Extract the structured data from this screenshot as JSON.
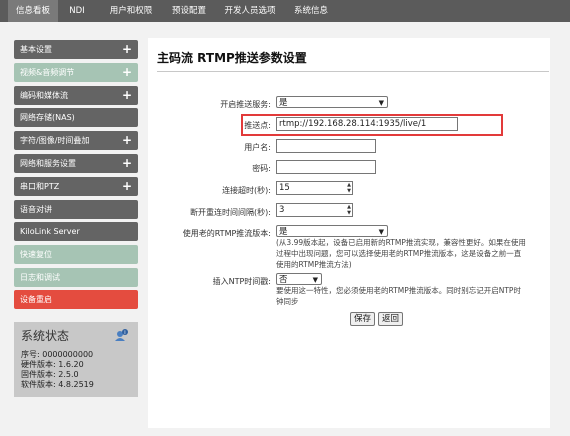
{
  "nav": {
    "tabs": [
      {
        "label": "信息看板"
      },
      {
        "label": "NDI"
      },
      {
        "label": "用户和权限"
      },
      {
        "label": "预设配置"
      },
      {
        "label": "开发人员选项"
      },
      {
        "label": "系统信息"
      }
    ]
  },
  "sidebar": {
    "items": [
      {
        "label": "基本设置",
        "plus": "+"
      },
      {
        "label": "视频&音频调节",
        "plus": "+"
      },
      {
        "label": "编码和媒体流",
        "plus": "+"
      },
      {
        "label": "网络存储(NAS)",
        "plus": ""
      },
      {
        "label": "字符/图像/时间叠加",
        "plus": "+"
      },
      {
        "label": "网络和服务设置",
        "plus": "+"
      },
      {
        "label": "串口和PTZ",
        "plus": "+"
      },
      {
        "label": "语音对讲",
        "plus": ""
      },
      {
        "label": "KiloLink Server",
        "plus": ""
      },
      {
        "label": "快速复位",
        "plus": ""
      },
      {
        "label": "日志和调试",
        "plus": ""
      },
      {
        "label": "设备重启",
        "plus": ""
      }
    ]
  },
  "status": {
    "title": "系统状态",
    "serial": "序号: 0000000000",
    "hardware": "硬件版本: 1.6.20",
    "firmware": "固件版本: 2.5.0",
    "software": "软件版本: 4.8.2519"
  },
  "form": {
    "title": "主码流 RTMP推送参数设置",
    "enable_label": "开启推送服务:",
    "enable_value": "是",
    "push_label": "推送点:",
    "push_value": "rtmp://192.168.28.114:1935/live/1",
    "user_label": "用户名:",
    "user_value": "",
    "pass_label": "密码:",
    "pass_value": "",
    "timeout_label": "连接超时(秒):",
    "timeout_value": "15",
    "reconnect_label": "断开重连时间间隔(秒):",
    "reconnect_value": "3",
    "legacy_label": "使用老的RTMP推流版本:",
    "legacy_value": "是",
    "legacy_note": [
      "(从3.99版本起，设备已启用新的RTMP推流实现，兼容性更好。如果在使用",
      "过程中出现问题，您可以选择使用老的RTMP推流版本，这是设备之前一直",
      "使用的RTMP推流方法)"
    ],
    "ntp_label": "插入NTP时间戳:",
    "ntp_value": "否",
    "ntp_note": [
      "要使用这一特性，您必须使用老的RTMP推流版本。同时别忘记开启NTP时",
      "钟同步"
    ],
    "save_label": "保存",
    "back_label": "返回"
  },
  "colors": {
    "topbar": "#5b5b5b",
    "sidebar_dark": "#646464",
    "sidebar_green": "#a6c4b4",
    "sidebar_red": "#e44c3f",
    "highlight": "#e23a3a"
  }
}
